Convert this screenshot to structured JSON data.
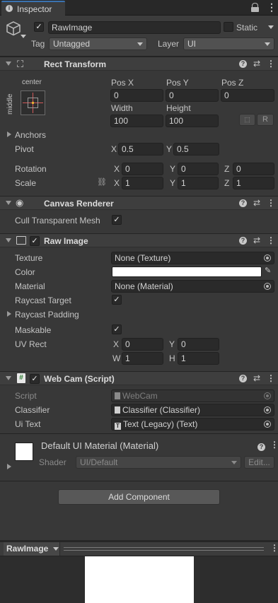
{
  "tab": {
    "title": "Inspector"
  },
  "object": {
    "name": "RawImage",
    "static_label": "Static",
    "tag_label": "Tag",
    "tag_value": "Untagged",
    "layer_label": "Layer",
    "layer_value": "UI"
  },
  "rect_transform": {
    "title": "Rect Transform",
    "anchor_h": "center",
    "anchor_v": "middle",
    "pos_x_label": "Pos X",
    "pos_y_label": "Pos Y",
    "pos_z_label": "Pos Z",
    "pos_x": "0",
    "pos_y": "0",
    "pos_z": "0",
    "width_label": "Width",
    "height_label": "Height",
    "width": "100",
    "height": "100",
    "r_button": "R",
    "anchors_label": "Anchors",
    "pivot_label": "Pivot",
    "pivot_x": "0.5",
    "pivot_y": "0.5",
    "rotation_label": "Rotation",
    "rot_x": "0",
    "rot_y": "0",
    "rot_z": "0",
    "scale_label": "Scale",
    "scale_x": "1",
    "scale_y": "1",
    "scale_z": "1",
    "x": "X",
    "y": "Y",
    "z": "Z"
  },
  "canvas_renderer": {
    "title": "Canvas Renderer",
    "cull_label": "Cull Transparent Mesh"
  },
  "raw_image": {
    "title": "Raw Image",
    "texture_label": "Texture",
    "texture_value": "None (Texture)",
    "color_label": "Color",
    "material_label": "Material",
    "material_value": "None (Material)",
    "raycast_target_label": "Raycast Target",
    "raycast_padding_label": "Raycast Padding",
    "maskable_label": "Maskable",
    "uvrect_label": "UV Rect",
    "uv_x": "0",
    "uv_y": "0",
    "uv_w": "1",
    "uv_h": "1",
    "x": "X",
    "y": "Y",
    "w": "W",
    "h": "H"
  },
  "webcam": {
    "title": "Web Cam (Script)",
    "script_label": "Script",
    "script_value": "WebCam",
    "classifier_label": "Classifier",
    "classifier_value": "Classifier (Classifier)",
    "uitext_label": "Ui Text",
    "uitext_value": "Text (Legacy) (Text)"
  },
  "material": {
    "title": "Default UI Material (Material)",
    "shader_label": "Shader",
    "shader_value": "UI/Default",
    "edit_button": "Edit..."
  },
  "add_component": "Add Component",
  "preview": {
    "title": "RawImage"
  },
  "colors": {
    "accent": "#3a72b0",
    "background": "#383838",
    "field": "#2a2a2a"
  }
}
